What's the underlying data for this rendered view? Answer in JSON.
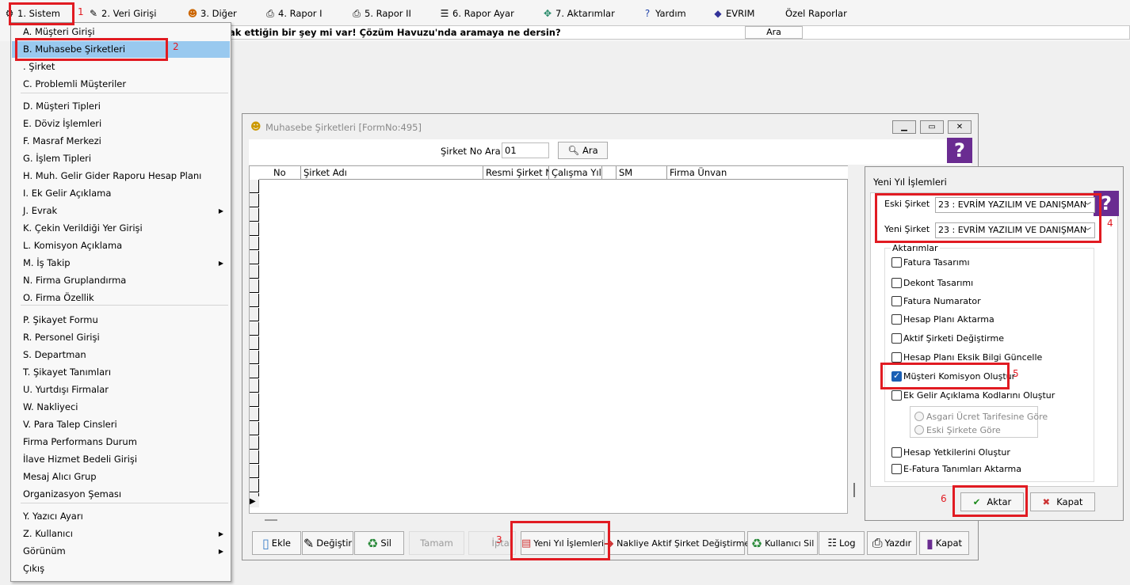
{
  "menubar": {
    "items": [
      {
        "label": "1.  Sistem",
        "icon": "gear-icon"
      },
      {
        "label": "2.  Veri Girişi",
        "icon": "pen-icon"
      },
      {
        "label": "3.  Diğer",
        "icon": "people-icon"
      },
      {
        "label": "4.  Rapor I",
        "icon": "printer-icon"
      },
      {
        "label": "5.  Rapor II",
        "icon": "printer-icon"
      },
      {
        "label": "6.  Rapor Ayar",
        "icon": "report-icon"
      },
      {
        "label": "7.  Aktarımlar",
        "icon": "transfer-icon"
      },
      {
        "label": "Yardım",
        "icon": "help-icon"
      },
      {
        "label": "EVRIM",
        "icon": "evrim-icon"
      },
      {
        "label": "Özel Raporlar",
        "icon": ""
      }
    ]
  },
  "search": {
    "text": "ak ettiğin bir şey mi var! Çözüm Havuzu'nda aramaya ne dersin?",
    "button": "Ara"
  },
  "dropdown": {
    "items": [
      "A.  Müşteri Girişi",
      "B.  Muhasebe Şirketleri",
      "  .  Şirket",
      "C.  Problemli Müşteriler",
      "D.  Müşteri Tipleri",
      "E.  Döviz İşlemleri",
      "F.  Masraf Merkezi",
      "G.  İşlem Tipleri",
      "H.  Muh. Gelir Gider Raporu Hesap Planı",
      "I.  Ek Gelir Açıklama",
      "J.  Evrak",
      "K.  Çekin Verildiği Yer Girişi",
      "L.  Komisyon Açıklama",
      "M.  İş Takip",
      "N.  Firma Gruplandırma",
      "O.  Firma Özellik",
      "P.  Şikayet Formu",
      "R.  Personel Girişi",
      "S.  Departman",
      "T.  Şikayet Tanımları",
      "U.  Yurtdışı Firmalar",
      "W.  Nakliyeci",
      "V.  Para Talep Cinsleri",
      "Firma Performans Durum",
      "İlave Hizmet Bedeli Girişi",
      "Mesaj Alıcı Grup",
      "Organizasyon Şeması",
      "Y.  Yazıcı Ayarı",
      "Z.  Kullanıcı",
      "Görünüm",
      "Çıkış"
    ]
  },
  "annotations": [
    "1",
    "2",
    "3",
    "4",
    "5",
    "6"
  ],
  "main_window": {
    "title": "Muhasebe Şirketleri [FormNo:495]",
    "search_label": "Şirket No Ara",
    "search_value": "01",
    "search_button": "Ara",
    "help": "?",
    "columns": [
      "No",
      "Şirket Adı",
      "Resmi Şirket No",
      "Çalışma Yılı",
      "",
      "SM",
      "Firma Ünvan"
    ],
    "toolbar": {
      "ekle": "Ekle",
      "degistir": "Değiştir",
      "sil": "Sil",
      "tamam": "Tamam",
      "iptal": "İptal",
      "yeni_yil": "Yeni Yıl İşlemleri",
      "nakliye": "Nakliye Aktif Şirket Değiştirme",
      "kullanici_sil": "Kullanıcı Sil",
      "log": "Log",
      "yazdir": "Yazdır",
      "kapat": "Kapat"
    }
  },
  "side_panel": {
    "title": "Yeni Yıl İşlemleri",
    "help": "?",
    "eski_label": "Eski Şirket",
    "eski_value": "23 : EVRİM YAZILIM  VE DANIŞMAN",
    "yeni_label": "Yeni Şirket",
    "yeni_value": "23 : EVRİM YAZILIM  VE DANIŞMAN",
    "group_label": "Aktarımlar",
    "checks": [
      {
        "label": "Fatura Tasarımı",
        "checked": false
      },
      {
        "label": "Dekont Tasarımı",
        "checked": false
      },
      {
        "label": "Fatura Numarator",
        "checked": false
      },
      {
        "label": "Hesap Planı Aktarma",
        "checked": false
      },
      {
        "label": "Aktif Şirketi Değiştirme",
        "checked": false
      },
      {
        "label": "Hesap Planı Eksik Bilgi Güncelle",
        "checked": false
      },
      {
        "label": "Müşteri Komisyon Oluştur",
        "checked": true
      },
      {
        "label": "Ek Gelir Açıklama Kodlarını Oluştur",
        "checked": false
      },
      {
        "label": "Hesap Yetkilerini Oluştur",
        "checked": false
      },
      {
        "label": "E-Fatura Tanımları Aktarma",
        "checked": false
      }
    ],
    "radios": [
      "Asgari Ücret Tarifesine Göre",
      "Eski Şirkete Göre"
    ],
    "aktar": "Aktar",
    "kapat": "Kapat"
  }
}
